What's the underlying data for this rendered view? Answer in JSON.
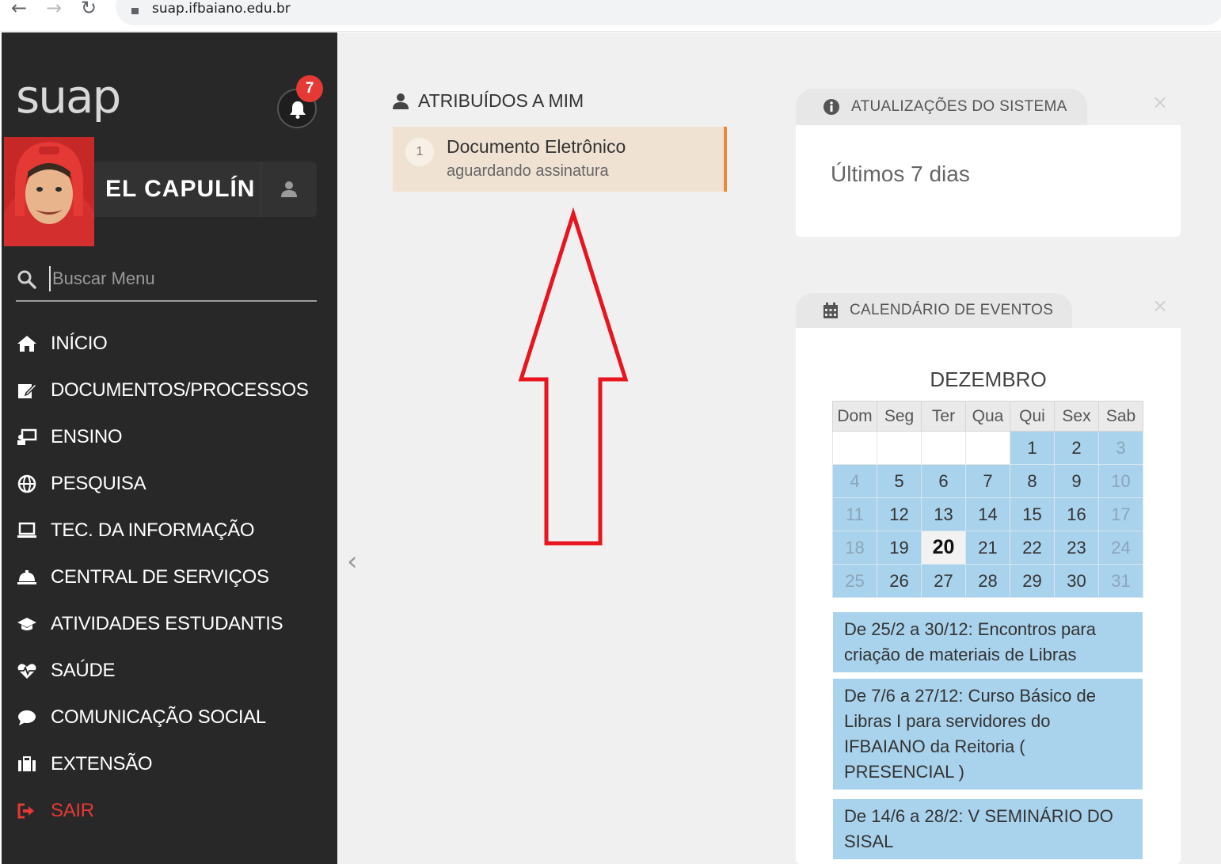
{
  "browser": {
    "url": "suap.ifbaiano.edu.br"
  },
  "sidebar": {
    "logo": "suap",
    "notifications_count": "7",
    "user_name": "EL CAPULÍN",
    "search_placeholder": "Buscar Menu",
    "items": [
      {
        "label": "INÍCIO",
        "icon": "home-icon"
      },
      {
        "label": "DOCUMENTOS/PROCESSOS",
        "icon": "edit-document-icon"
      },
      {
        "label": "ENSINO",
        "icon": "teaching-icon"
      },
      {
        "label": "PESQUISA",
        "icon": "globe-icon"
      },
      {
        "label": "TEC. DA INFORMAÇÃO",
        "icon": "laptop-icon"
      },
      {
        "label": "CENTRAL DE SERVIÇOS",
        "icon": "service-bell-icon"
      },
      {
        "label": "ATIVIDADES ESTUDANTIS",
        "icon": "graduation-cap-icon"
      },
      {
        "label": "SAÚDE",
        "icon": "heartbeat-icon"
      },
      {
        "label": "COMUNICAÇÃO SOCIAL",
        "icon": "comment-icon"
      },
      {
        "label": "EXTENSÃO",
        "icon": "briefcase-icon"
      },
      {
        "label": "SAIR",
        "icon": "sign-out-icon"
      }
    ]
  },
  "assigned": {
    "title": "ATRIBUÍDOS A MIM",
    "items": [
      {
        "number": "1",
        "title": "Documento Eletrônico",
        "subtitle": "aguardando assinatura"
      }
    ]
  },
  "updates": {
    "title": "ATUALIZAÇÕES DO SISTEMA",
    "text": "Últimos 7 dias"
  },
  "calendar": {
    "title": "CALENDÁRIO DE EVENTOS",
    "month": "DEZEMBRO",
    "weekdays": [
      "Dom",
      "Seg",
      "Ter",
      "Qua",
      "Qui",
      "Sex",
      "Sab"
    ],
    "weeks": [
      [
        "",
        "",
        "",
        "",
        "1",
        "2",
        "3"
      ],
      [
        "4",
        "5",
        "6",
        "7",
        "8",
        "9",
        "10"
      ],
      [
        "11",
        "12",
        "13",
        "14",
        "15",
        "16",
        "17"
      ],
      [
        "18",
        "19",
        "20",
        "21",
        "22",
        "23",
        "24"
      ],
      [
        "25",
        "26",
        "27",
        "28",
        "29",
        "30",
        "31"
      ]
    ],
    "today": "20",
    "events": [
      "De 25/2 a 30/12: Encontros para criação de materiais de Libras",
      "De 7/6 a 27/12: Curso Básico de Libras I para servidores do IFBAIANO da Reitoria ( PRESENCIAL )",
      "De 14/6 a 28/2: V SEMINÁRIO DO SISAL"
    ]
  },
  "colors": {
    "sidebar_bg": "#282828",
    "accent_orange": "#e8893b",
    "calendar_blue": "#a9d2ec",
    "badge_red": "#e53935",
    "arrow_red": "#e8141e"
  }
}
